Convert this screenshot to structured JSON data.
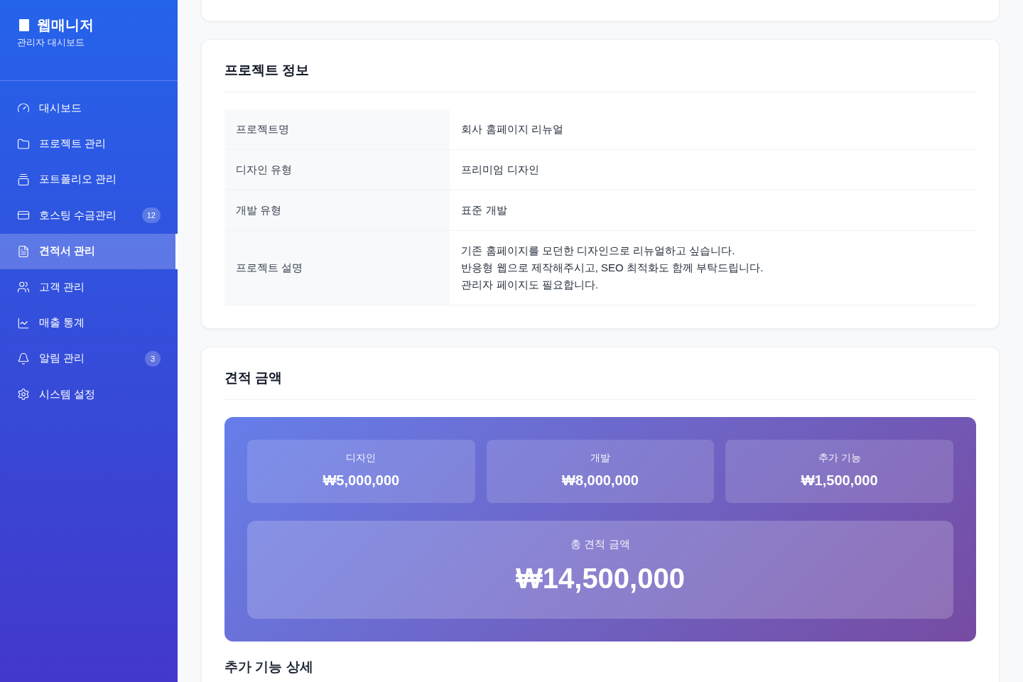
{
  "sidebar": {
    "logo": {
      "title": "웹매니저",
      "subtitle": "관리자 대시보드"
    },
    "items": [
      {
        "label": "대시보드",
        "selected": false
      },
      {
        "label": "프로젝트 관리",
        "selected": false
      },
      {
        "label": "포트폴리오 관리",
        "selected": false
      },
      {
        "label": "호스팅 수금관리",
        "selected": false,
        "badge": "12"
      },
      {
        "label": "견적서 관리",
        "selected": true
      },
      {
        "label": "고객 관리",
        "selected": false
      },
      {
        "label": "매출 통계",
        "selected": false
      },
      {
        "label": "알림 관리",
        "selected": false,
        "badge": "3"
      },
      {
        "label": "시스템 설정",
        "selected": false
      }
    ]
  },
  "project_info": {
    "title": "프로젝트 정보",
    "rows": [
      {
        "label": "프로젝트명",
        "value": "회사 홈페이지 리뉴얼"
      },
      {
        "label": "디자인 유형",
        "value": "프리미엄 디자인"
      },
      {
        "label": "개발 유형",
        "value": "표준 개발"
      },
      {
        "label": "프로젝트 설명",
        "value": "기존 홈페이지를 모던한 디자인으로 리뉴얼하고 싶습니다.\n반응형 웹으로 제작해주시고, SEO 최적화도 함께 부탁드립니다.\n관리자 페이지도 필요합니다."
      }
    ]
  },
  "estimate": {
    "title": "견적 금액",
    "items": [
      {
        "label": "디자인",
        "amount": "₩5,000,000"
      },
      {
        "label": "개발",
        "amount": "₩8,000,000"
      },
      {
        "label": "추가 기능",
        "amount": "₩1,500,000"
      }
    ],
    "total": {
      "label": "총 견적 금액",
      "amount": "₩14,500,000"
    },
    "subheading": "추가 기능 상세"
  }
}
